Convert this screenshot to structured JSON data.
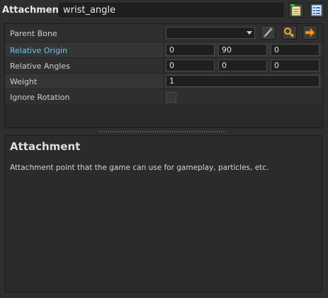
{
  "header": {
    "title": "Attachment",
    "name_value": "wrist_angle",
    "buttons": [
      {
        "icon": "new-sheet-icon"
      },
      {
        "icon": "properties-list-icon"
      }
    ]
  },
  "properties": [
    {
      "label": "Parent Bone",
      "type": "dropdown",
      "value": "",
      "buttons": [
        "pick-eyedropper-icon",
        "key-search-icon",
        "go-to-arrow-icon"
      ]
    },
    {
      "label": "Relative Origin",
      "type": "vector",
      "values": [
        "0",
        "90",
        "0"
      ],
      "highlighted": true
    },
    {
      "label": "Relative Angles",
      "type": "vector",
      "values": [
        "0",
        "0",
        "0"
      ]
    },
    {
      "label": "Weight",
      "type": "number",
      "value": "1"
    },
    {
      "label": "Ignore Rotation",
      "type": "checkbox",
      "checked": false
    }
  ],
  "description": {
    "title": "Attachment",
    "text": "Attachment point that the game can use for gameplay, particles, etc."
  },
  "colors": {
    "accent_label": "#6cc6e6",
    "background": "#2e2e2e"
  }
}
